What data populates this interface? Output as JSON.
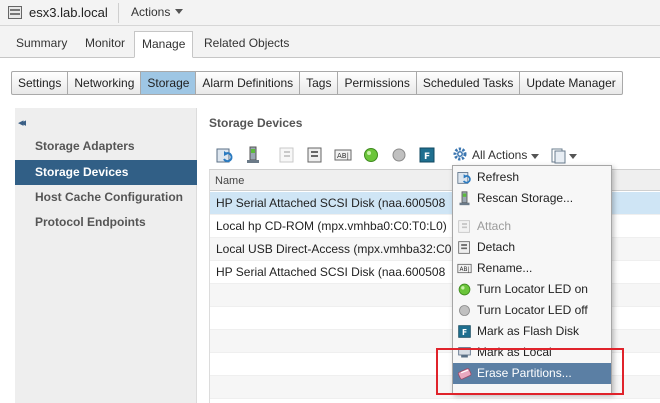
{
  "header": {
    "host_name": "esx3.lab.local",
    "actions_label": "Actions"
  },
  "main_tabs": [
    {
      "label": "Summary"
    },
    {
      "label": "Monitor"
    },
    {
      "label": "Manage",
      "active": true
    },
    {
      "label": "Related Objects"
    }
  ],
  "sub_tabs": [
    {
      "label": "Settings"
    },
    {
      "label": "Networking"
    },
    {
      "label": "Storage",
      "active": true
    },
    {
      "label": "Alarm Definitions"
    },
    {
      "label": "Tags"
    },
    {
      "label": "Permissions"
    },
    {
      "label": "Scheduled Tasks"
    },
    {
      "label": "Update Manager"
    }
  ],
  "nav": {
    "collapse_glyph": "◂◂",
    "items": [
      {
        "label": "Storage Adapters"
      },
      {
        "label": "Storage Devices",
        "selected": true
      },
      {
        "label": "Host Cache Configuration"
      },
      {
        "label": "Protocol Endpoints"
      }
    ]
  },
  "content": {
    "title": "Storage Devices",
    "all_actions_label": "All Actions",
    "column_name": "Name",
    "rows": [
      {
        "name": "HP Serial Attached SCSI Disk (naa.600508",
        "selected": true
      },
      {
        "name": "Local hp CD-ROM (mpx.vmhba0:C0:T0:L0)"
      },
      {
        "name": "Local USB Direct-Access (mpx.vmhba32:C0"
      },
      {
        "name": "HP Serial Attached SCSI Disk (naa.600508"
      }
    ]
  },
  "context_menu": {
    "items": [
      {
        "label": "Refresh",
        "icon": "refresh-icon",
        "disabled": false
      },
      {
        "label": "Rescan Storage...",
        "icon": "rescan-icon",
        "disabled": false
      },
      {
        "label": "Attach",
        "icon": "attach-icon",
        "disabled": true
      },
      {
        "label": "Detach",
        "icon": "detach-icon",
        "disabled": false
      },
      {
        "label": "Rename...",
        "icon": "rename-icon",
        "disabled": false
      },
      {
        "label": "Turn Locator LED on",
        "icon": "led-on-icon",
        "disabled": false
      },
      {
        "label": "Turn Locator LED off",
        "icon": "led-off-icon",
        "disabled": false
      },
      {
        "label": "Mark as Flash Disk",
        "icon": "flash-disk-icon",
        "disabled": false
      },
      {
        "label": "Mark as Local",
        "icon": "mark-local-icon",
        "disabled": false
      },
      {
        "label": "Erase Partitions...",
        "icon": "erase-partitions-icon",
        "disabled": false,
        "highlighted": true
      }
    ]
  },
  "colors": {
    "nav_selected": "#315f86",
    "sub_tab_active": "#9ec6e4",
    "row_selected": "#cfe5f5",
    "menu_highlight": "#5b7fa4",
    "annotation_box": "#e0232b"
  }
}
